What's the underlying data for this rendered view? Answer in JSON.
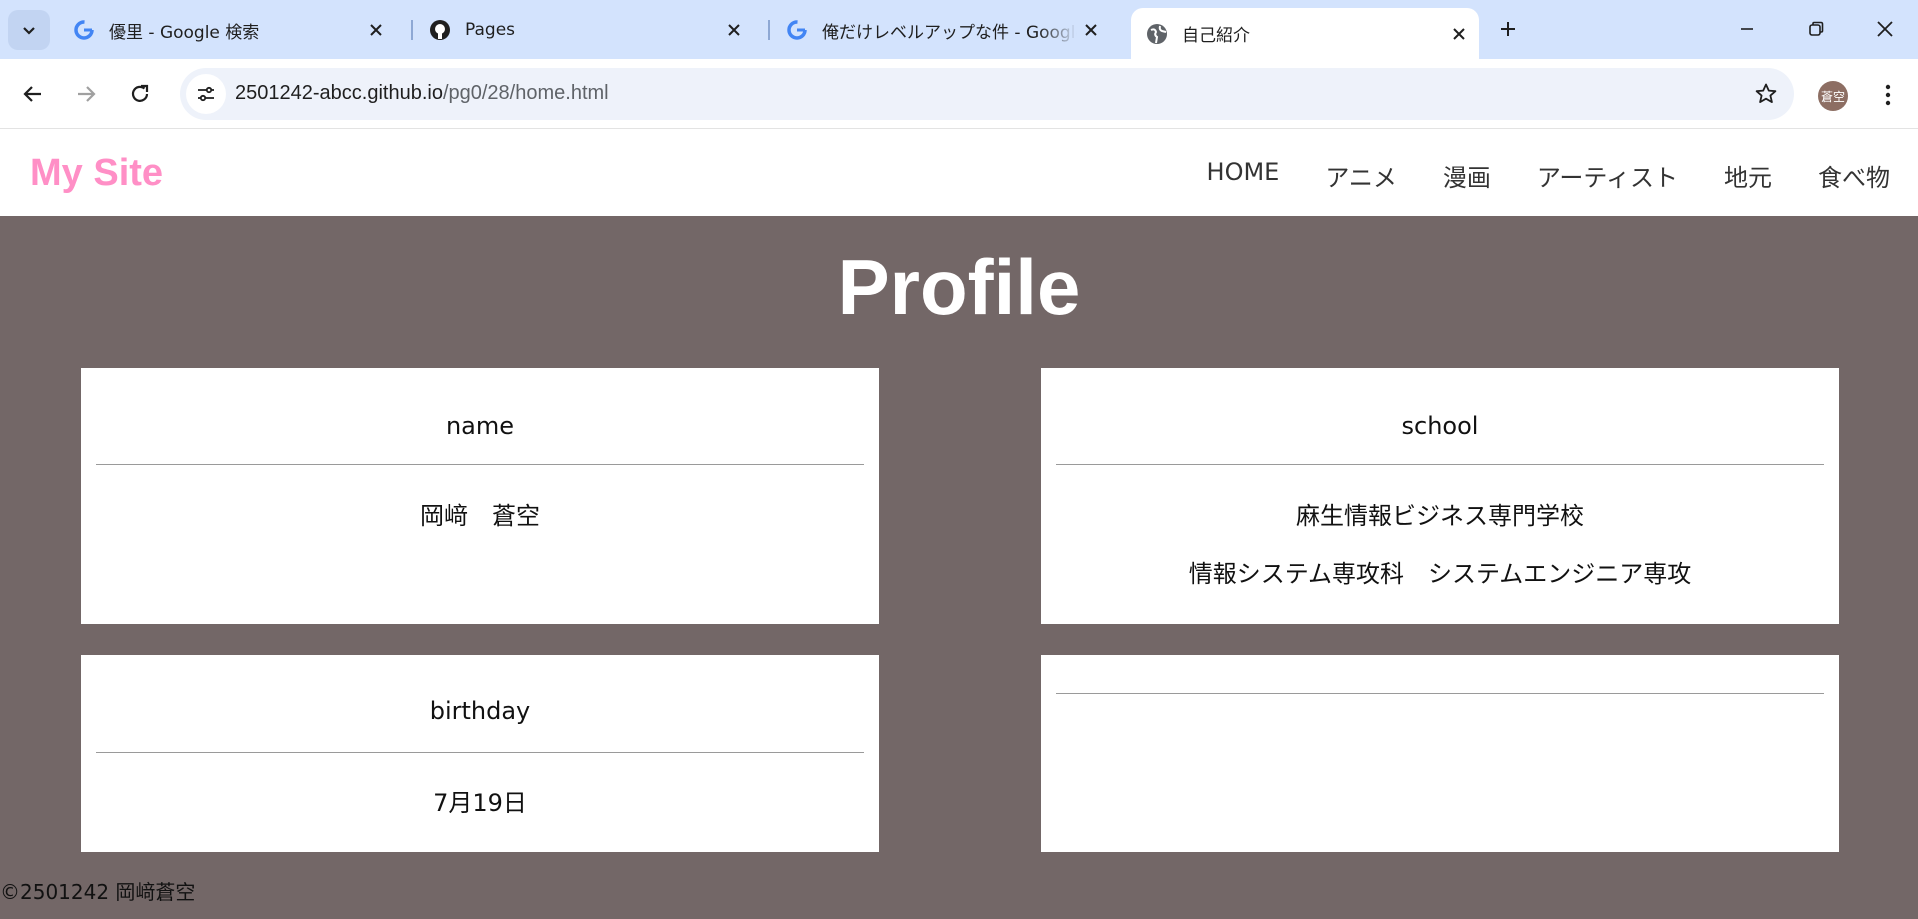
{
  "browser": {
    "tabs": [
      {
        "title": "優里 - Google 検索",
        "favicon": "google-icon"
      },
      {
        "title": "Pages",
        "favicon": "github-icon"
      },
      {
        "title": "俺だけレベルアップな件 - Google 検",
        "favicon": "google-icon"
      },
      {
        "title": "自己紹介",
        "favicon": "globe-icon",
        "active": true
      }
    ],
    "url_host": "2501242-abcc.github.io",
    "url_path": "/pg0/28/home.html",
    "profile_initials": "蒼空"
  },
  "site": {
    "logo": "My Site",
    "nav": [
      "HOME",
      "アニメ",
      "漫画",
      "アーティスト",
      "地元",
      "食べ物"
    ],
    "hero_title": "Profile",
    "cards": {
      "name": {
        "heading": "name",
        "lines": [
          "岡﨑　蒼空"
        ]
      },
      "school": {
        "heading": "school",
        "lines": [
          "麻生情報ビジネス専門学校",
          "情報システム専攻科　システムエンジニア専攻"
        ]
      },
      "birthday": {
        "heading": "birthday",
        "lines": [
          "7月19日"
        ]
      },
      "empty": {
        "heading": "",
        "lines": []
      }
    },
    "footer": "©2501242 岡﨑蒼空"
  },
  "colors": {
    "tabstrip": "#d3e3fd",
    "page_bg": "#736767",
    "logo": "#ff8fc6",
    "card_bg": "#ffffff"
  }
}
